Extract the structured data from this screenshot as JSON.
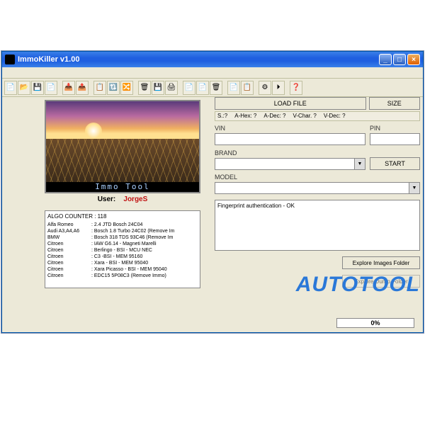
{
  "window": {
    "title": "ImmoKiller v1.00"
  },
  "toolbar_icons": [
    "📄",
    "📂",
    "💾",
    "📄",
    "",
    "📥",
    "📤",
    "",
    "📋",
    "🔃",
    "🔀",
    "",
    "🗑",
    "💾",
    "🖨",
    "",
    "📄",
    "📄",
    "🗑",
    "",
    "📄",
    "📋",
    "",
    "⚙",
    "⏵",
    "",
    "❓"
  ],
  "preview": {
    "brand_text": "Immo Tool"
  },
  "user": {
    "label": "User:",
    "name": "JorgeS"
  },
  "algo": {
    "header": "ALGO COUNTER : 118",
    "rows": [
      {
        "brand": "Alfa Romeo",
        "desc": ": 2.4 JTD Bosch 24C04"
      },
      {
        "brand": "Audi A3,A4,A6",
        "desc": ": Bosch 1.8 Turbo 24C02 (Remove Im"
      },
      {
        "brand": "BMW",
        "desc": ": Bosch 318 TDS 93C46 (Remove Im"
      },
      {
        "brand": "Citroen",
        "desc": ": IAW G6.14 - Magneti Marelli"
      },
      {
        "brand": "Citroen",
        "desc": ": Berlingo - BSI - MCU NEC"
      },
      {
        "brand": "Citroen",
        "desc": ": C3 -BSI - MEM 95160"
      },
      {
        "brand": "Citroen",
        "desc": ": Xara - BSI - MEM 95040"
      },
      {
        "brand": "Citroen",
        "desc": ": Xara Picasso   - BSI - MEM 95040"
      },
      {
        "brand": "Citroen",
        "desc": ": EDC15 5P08C3 (Remove Immo)"
      }
    ]
  },
  "right": {
    "load_file": "LOAD FILE",
    "size": "SIZE",
    "stats": {
      "s": "S.:?",
      "ahex": "A-Hex: ?",
      "adec": "A-Dec: ?",
      "vchar": "V-Char. ?",
      "vdec": "V-Dec: ?"
    },
    "vin_label": "VIN",
    "pin_label": "PIN",
    "brand_label": "BRAND",
    "start_label": "START",
    "model_label": "MODEL",
    "message": "Fingerprint authentication - OK",
    "explore": "Explore Images Folder",
    "explore2": "Explore Dump Folder",
    "progress": "0%"
  },
  "watermark": "AUTOTOOL"
}
